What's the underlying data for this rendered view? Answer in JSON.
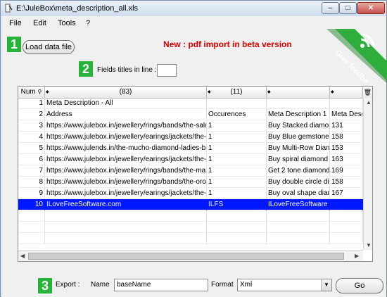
{
  "window": {
    "title": "E:\\JuleBox\\meta_description_all.xls",
    "controls": {
      "minimize": "–",
      "maximize": "□",
      "close": "✕"
    }
  },
  "menu": [
    "File",
    "Edit",
    "Tools",
    "?"
  ],
  "steps": [
    "1",
    "2",
    "3"
  ],
  "toolbar": {
    "load_label": "Load data file",
    "beta_notice": "New : pdf import in beta version",
    "feedback_label": "Give feedback"
  },
  "fields_titles": {
    "label": "Fields titles in line :",
    "value": ""
  },
  "grid": {
    "headers": [
      "Num",
      "(83)",
      "(11)",
      "",
      ""
    ],
    "rows": [
      [
        "1",
        "Meta Description - All",
        "",
        "",
        ""
      ],
      [
        "2",
        "Address",
        "Occurences",
        "Meta Description 1",
        "Meta Desc"
      ],
      [
        "3",
        "https://www.julebox.in/jewellery/rings/bands/the-salud",
        "1",
        "Buy Stacked diamor",
        "131"
      ],
      [
        "4",
        "https://www.julebox.in/jewellery/earings/jackets/the-se",
        "1",
        "Buy Blue gemstone r",
        "158"
      ],
      [
        "5",
        "https://www.julends.in/the-mucho-diamond-ladies-band.ht",
        "1",
        "Buy Multi-Row Diaml",
        "153"
      ],
      [
        "6",
        "https://www.julebox.in/jewellery/earings/jackets/the-ar",
        "1",
        "Buy spiral diamond e",
        "163"
      ],
      [
        "7",
        "https://www.julebox.in/jewellery/rings/bands/the-mana",
        "1",
        "Get 2 tone diamond",
        "169"
      ],
      [
        "8",
        "https://www.julebox.in/jewellery/rings/bands/the-oro-di",
        "1",
        "Buy double circle dia",
        "158"
      ],
      [
        "9",
        "https://www.julebox.in/jewellery/earings/jackets/the-pe",
        "1",
        "Buy oval shape diam",
        "167"
      ],
      [
        "10",
        "ILoveFreeSoftware.com",
        "ILFS",
        "ILoveFreeSoftware",
        ""
      ]
    ],
    "selected_row": 10
  },
  "export": {
    "label": "Export :",
    "name_label": "Name",
    "name_value": "baseName",
    "format_label": "Format",
    "format_value": "Xml",
    "go_label": "Go"
  },
  "colors": {
    "step_badge": "#27b23a",
    "beta_text": "#e00000",
    "selection": "#0018ff",
    "feedback_ribbon": "#2fae3e"
  }
}
